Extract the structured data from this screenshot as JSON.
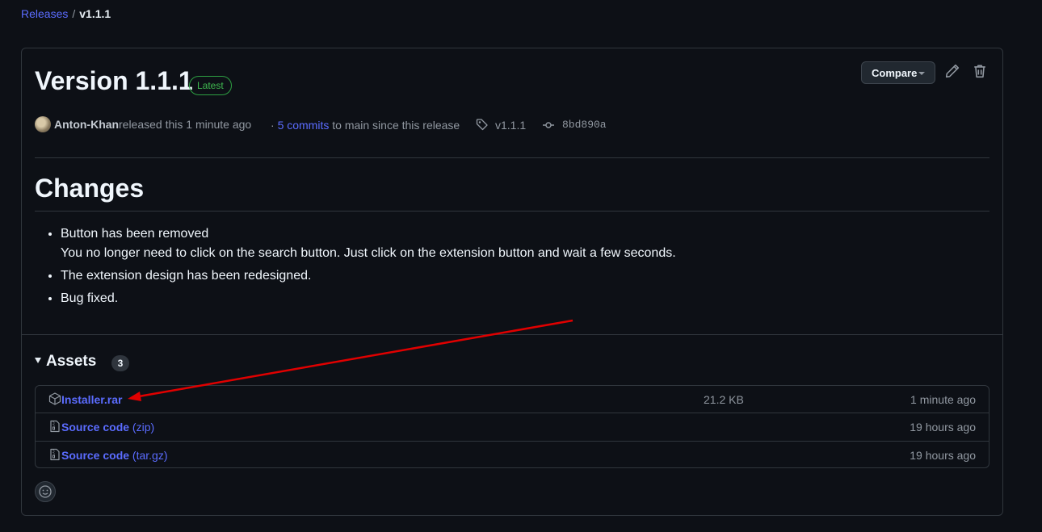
{
  "breadcrumb": {
    "parent": "Releases",
    "separator": "/",
    "current": "v1.1.1"
  },
  "release": {
    "title": "Version 1.1.1",
    "badge": "Latest",
    "compare_label": "Compare",
    "author": "Anton-Khan",
    "released_text": "released this 1 minute ago",
    "commits_prefix": "·",
    "commits_link": "5 commits",
    "commits_suffix": "to main since this release",
    "tag": "v1.1.1",
    "commit_sha": "8bd890a"
  },
  "notes": {
    "heading": "Changes",
    "items": [
      "Button has been removed",
      "You no longer need to click on the search button. Just click on the extension button and wait a few seconds.",
      "The extension design has been redesigned.",
      "Bug fixed."
    ]
  },
  "assets": {
    "heading": "Assets",
    "count": "3",
    "rows": [
      {
        "name": "Installer.rar",
        "format": "",
        "size": "21.2 KB",
        "time": "1 minute ago",
        "icon": "package-icon"
      },
      {
        "name": "Source code",
        "format": "(zip)",
        "size": "",
        "time": "19 hours ago",
        "icon": "file-zip-icon"
      },
      {
        "name": "Source code",
        "format": "(tar.gz)",
        "size": "",
        "time": "19 hours ago",
        "icon": "file-zip-icon"
      }
    ]
  },
  "colors": {
    "accent_link": "#5b6cff",
    "latest_badge": "#3fb950",
    "annotation_arrow": "#e00000",
    "background": "#0d1016"
  }
}
